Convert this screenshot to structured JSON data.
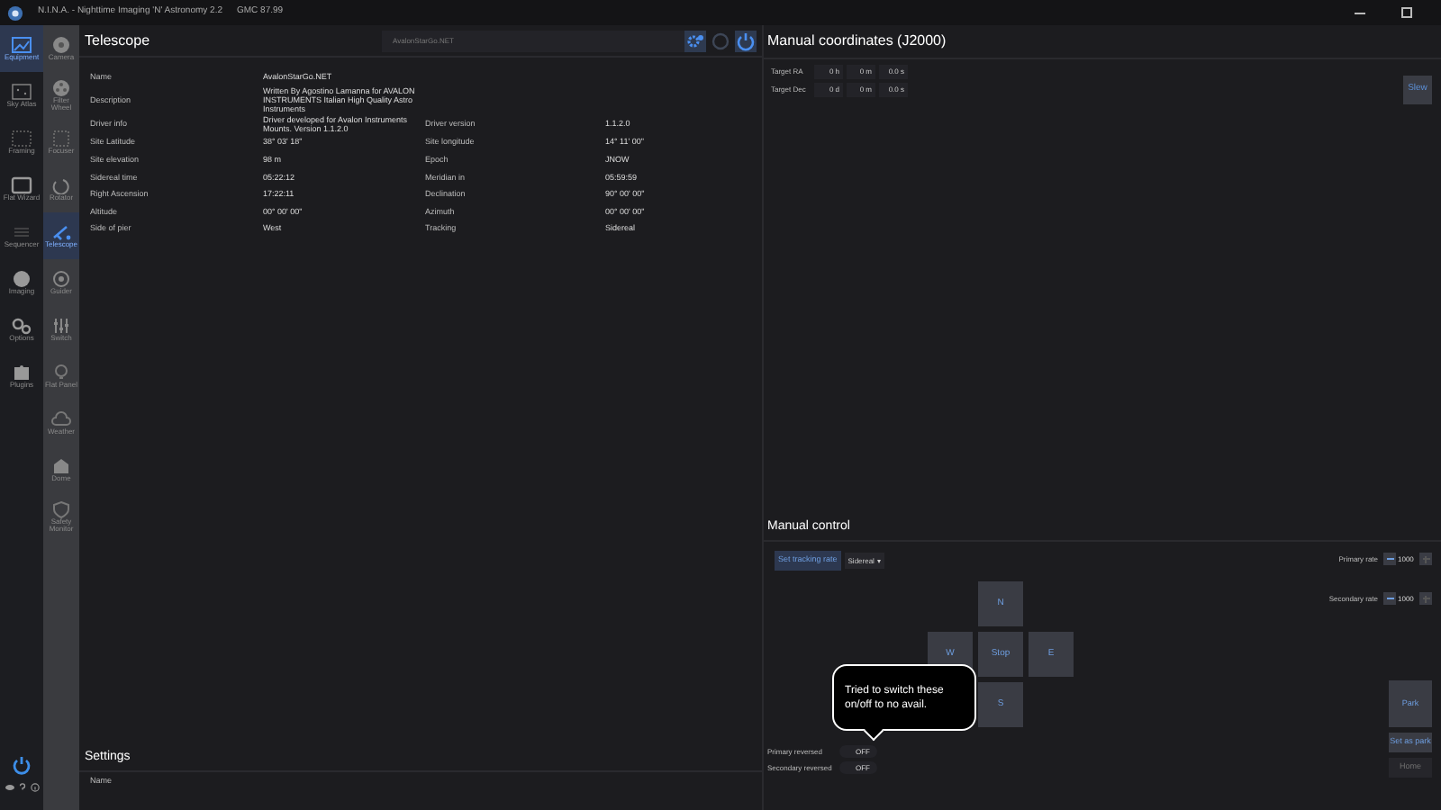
{
  "window": {
    "title": "N.I.N.A. - Nighttime Imaging 'N' Astronomy 2.2",
    "subtitle": "GMC 87.99"
  },
  "nav": [
    {
      "label": "Equipment",
      "selected": true
    },
    {
      "label": "Sky Atlas",
      "selected": false
    },
    {
      "label": "Framing",
      "selected": false
    },
    {
      "label": "Flat Wizard",
      "selected": false
    },
    {
      "label": "Sequencer",
      "selected": false
    },
    {
      "label": "Imaging",
      "selected": false
    },
    {
      "label": "Options",
      "selected": false
    },
    {
      "label": "Plugins",
      "selected": false
    }
  ],
  "equipment_nav": [
    {
      "label": "Camera",
      "selected": false
    },
    {
      "label": "Filter Wheel",
      "selected": false
    },
    {
      "label": "Focuser",
      "selected": false
    },
    {
      "label": "Rotator",
      "selected": false
    },
    {
      "label": "Telescope",
      "selected": true
    },
    {
      "label": "Guider",
      "selected": false
    },
    {
      "label": "Switch",
      "selected": false
    },
    {
      "label": "Flat Panel",
      "selected": false
    },
    {
      "label": "Weather",
      "selected": false
    },
    {
      "label": "Dome",
      "selected": false
    },
    {
      "label": "Safety Monitor",
      "selected": false
    }
  ],
  "telescope": {
    "title": "Telescope",
    "device": "AvalonStarGo.NET",
    "rows": [
      {
        "label": "Name",
        "value": "AvalonStarGo.NET"
      },
      {
        "label": "Description",
        "value": "Written By Agostino Lamanna for AVALON INSTRUMENTS Italian High Quality Astro Instruments"
      },
      {
        "label": "Driver info",
        "value": "Driver developed for Avalon Instruments Mounts. Version 1.1.2.0",
        "label_2": "Driver version",
        "value_2": "1.1.2.0"
      },
      {
        "label": "Site Latitude",
        "value": "38° 03' 18\"",
        "label_2": "Site longitude",
        "value_2": "14° 11' 00\""
      },
      {
        "label": "Site elevation",
        "value": "98 m",
        "label_2": "Epoch",
        "value_2": "JNOW"
      },
      {
        "label": "Sidereal time",
        "value": "05:22:12",
        "label_2": "Meridian in",
        "value_2": "05:59:59"
      },
      {
        "label": "Right Ascension",
        "value": "17:22:11",
        "label_2": "Declination",
        "value_2": "90° 00' 00\""
      },
      {
        "label": "Altitude",
        "value": "00° 00' 00\"",
        "label_2": "Azimuth",
        "value_2": "00° 00' 00\""
      },
      {
        "label": "Side of pier",
        "value": "West",
        "label_2": "Tracking",
        "value_2": "Sidereal"
      }
    ]
  },
  "settings": {
    "title": "Settings",
    "columns": [
      "Name"
    ]
  },
  "manual_coordinates": {
    "title": "Manual coordinates (J2000)",
    "rows": [
      {
        "label": "Target RA",
        "fields": [
          "0 h",
          "0 m",
          "0.0 s"
        ]
      },
      {
        "label": "Target Dec",
        "fields": [
          "0 d",
          "0 m",
          "0.0 s"
        ]
      }
    ],
    "slew": "Slew"
  },
  "manual_control": {
    "title": "Manual control",
    "tracking_button": "Set tracking rate",
    "tracking_rate": "Sidereal",
    "rates": [
      {
        "label": "Primary rate",
        "value": "1000"
      },
      {
        "label": "Secondary rate",
        "value": "1000"
      }
    ],
    "directions": {
      "north": "N",
      "west": "W",
      "stop": "Stop",
      "east": "E",
      "south": "S"
    },
    "toggles": [
      {
        "label": "Primary reversed",
        "text": "OFF",
        "on": false
      },
      {
        "label": "Secondary reversed",
        "text": "OFF",
        "on": false
      }
    ],
    "buttons": [
      {
        "label": "Park",
        "disabled": false
      },
      {
        "label": "Set as park",
        "disabled": false
      },
      {
        "label": "Home",
        "disabled": true
      }
    ]
  },
  "callout": {
    "text": "Tried to switch these on/off to no avail."
  }
}
